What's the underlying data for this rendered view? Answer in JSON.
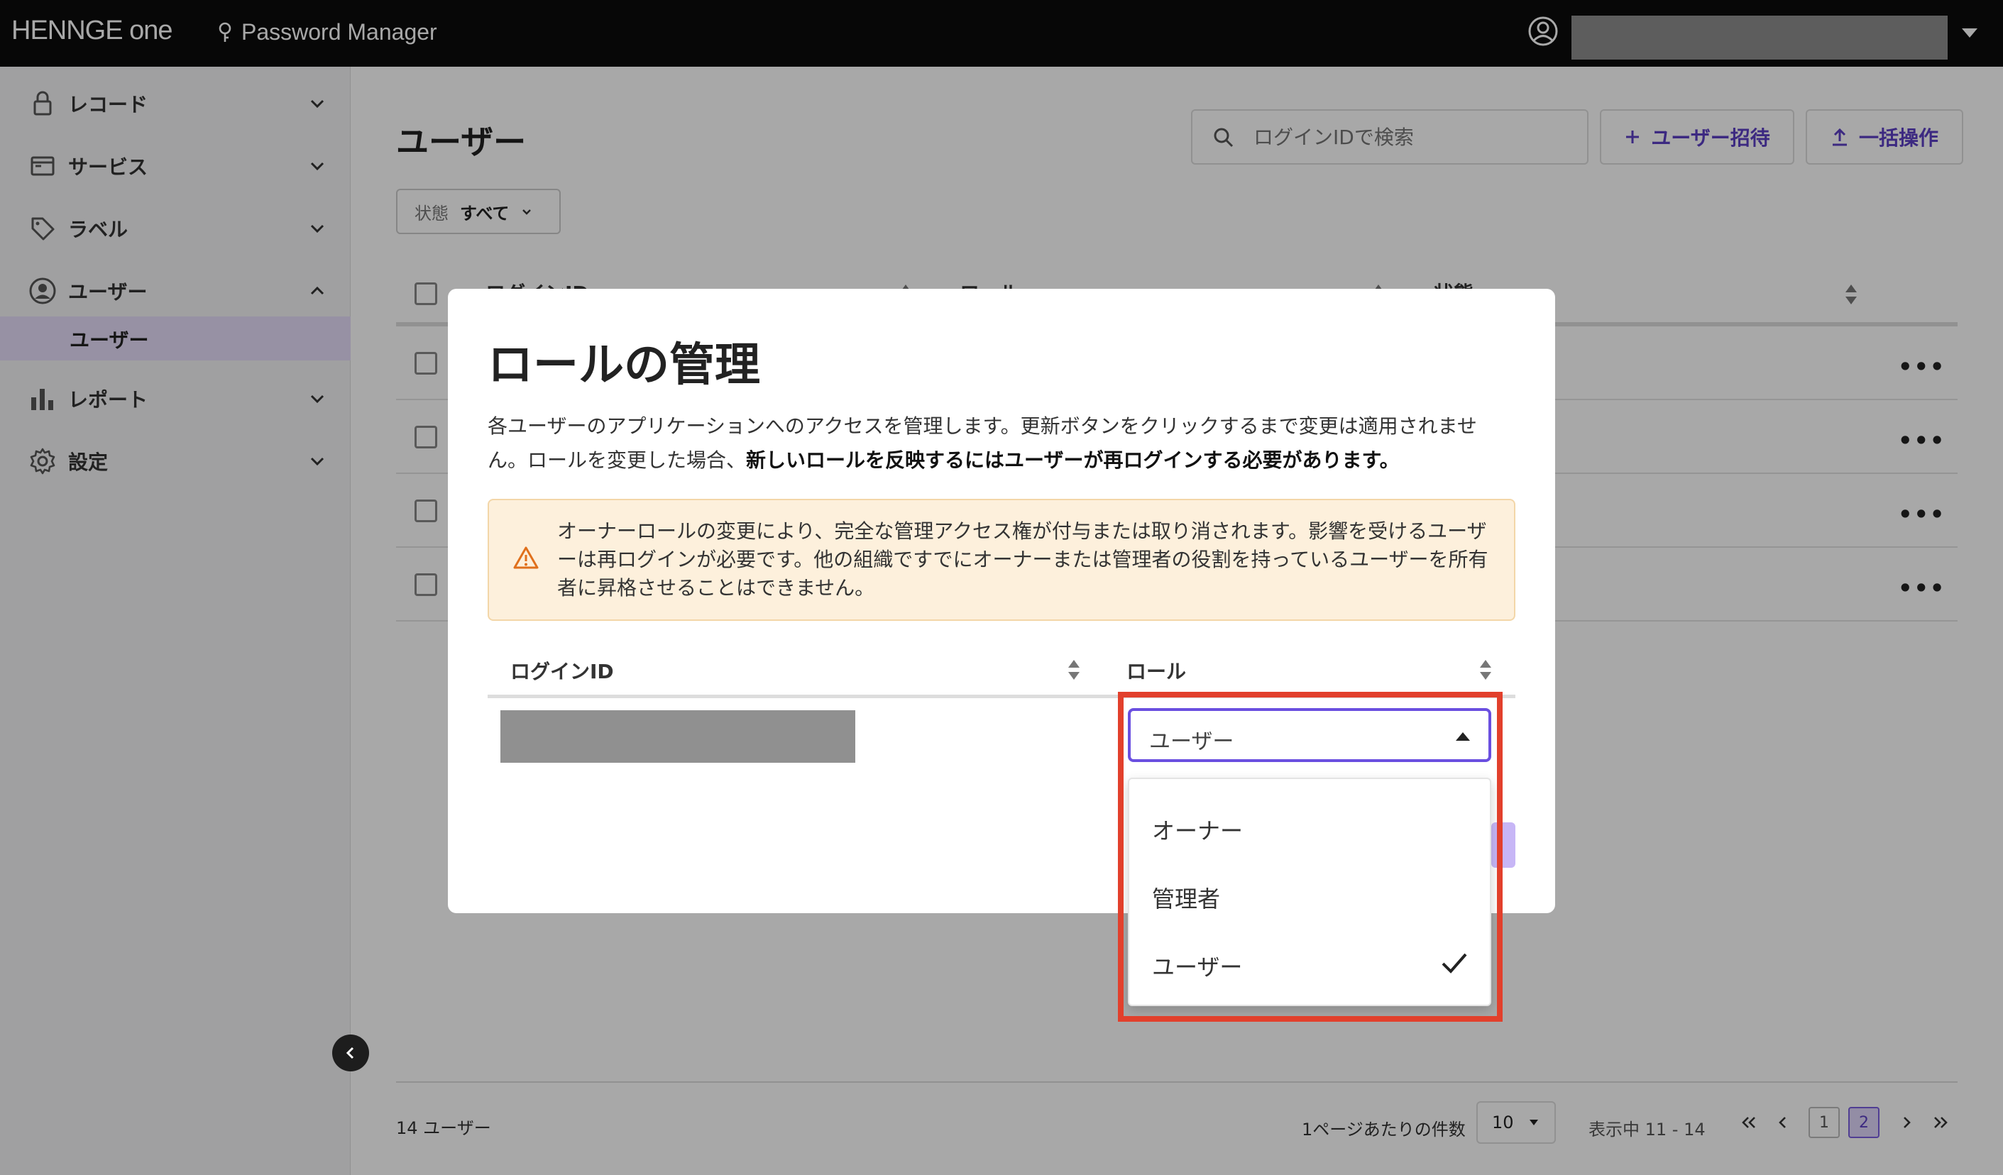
{
  "topbar": {
    "brand": "HENNGE",
    "brand_suffix": "one",
    "product": "Password Manager"
  },
  "sidebar": {
    "items": [
      {
        "label": "レコード",
        "icon": "lock-icon"
      },
      {
        "label": "サービス",
        "icon": "browser-window-icon"
      },
      {
        "label": "ラベル",
        "icon": "tag-icon"
      },
      {
        "label": "ユーザー",
        "icon": "user-circle-icon"
      },
      {
        "label": "レポート",
        "icon": "bar-chart-icon"
      },
      {
        "label": "設定",
        "icon": "gear-icon"
      }
    ],
    "sub_item": "ユーザー"
  },
  "main": {
    "title": "ユーザー",
    "search_placeholder": "ログインIDで検索",
    "invite_button": "ユーザー招待",
    "bulk_button": "一括操作",
    "filter_key": "状態",
    "filter_value": "すべて",
    "columns": [
      "ログインID",
      "ロール",
      "状態"
    ],
    "footer_count": "14 ユーザー",
    "per_page_label": "1ページあたりの件数",
    "per_page_value": "10",
    "range": "表示中 11 - 14",
    "pages": [
      "1",
      "2"
    ],
    "current_page": "2"
  },
  "modal": {
    "title": "ロールの管理",
    "desc_plain": "各ユーザーのアプリケーションへのアクセスを管理します。更新ボタンをクリックするまで変更は適用されません。ロールを変更した場合、",
    "desc_bold": "新しいロールを反映するにはユーザーが再ログインする必要があります。",
    "warning": "オーナーロールの変更により、完全な管理アクセス権が付与または取り消されます。影響を受けるユーザーは再ログインが必要です。他の組織ですでにオーナーまたは管理者の役割を持っているユーザーを所有者に昇格させることはできません。",
    "col_login": "ログインID",
    "col_role": "ロール",
    "role_select_value": "ユーザー",
    "role_options": [
      "オーナー",
      "管理者",
      "ユーザー"
    ],
    "selected_option": "ユーザー"
  },
  "colors": {
    "accent": "#5b3fc4",
    "highlight": "#e2402c",
    "warning_bg": "#fdf0dc",
    "warning_icon": "#e0701c"
  }
}
